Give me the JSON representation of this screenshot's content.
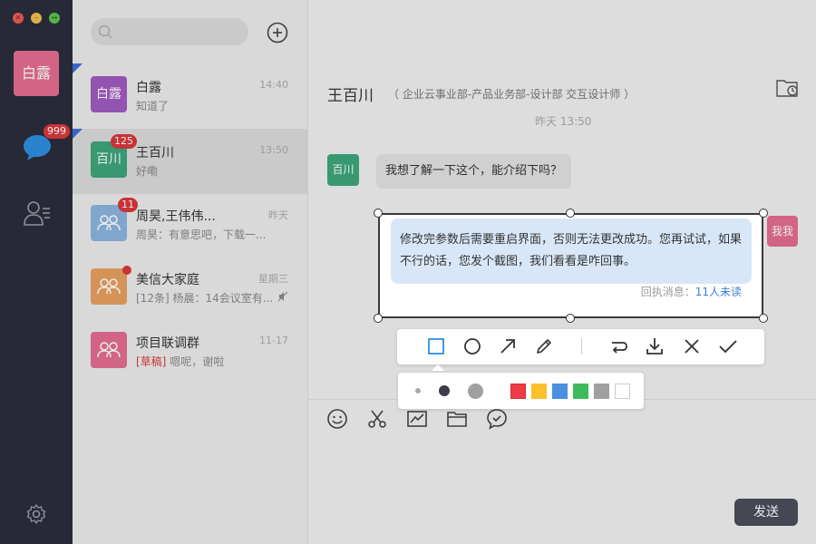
{
  "sidebar": {
    "user_avatar_text": "白露",
    "unread_badge": "999"
  },
  "search": {
    "placeholder": ""
  },
  "conversations": [
    {
      "name": "白露",
      "preview": "知道了",
      "time": "14:40",
      "avatar_text": "白露",
      "avatar_color": "#a05bbf",
      "badge": "",
      "pinned": true
    },
    {
      "name": "王百川",
      "preview": "好嘞",
      "time": "13:50",
      "avatar_text": "百川",
      "avatar_color": "#3da57b",
      "badge": "125",
      "pinned": true
    },
    {
      "name": "周昊,王伟伟...",
      "preview": "周昊：有意思吧，下载一...",
      "time": "昨天",
      "avatar_text": "",
      "avatar_color": "#8bb5e0",
      "badge": "11",
      "pinned": false
    },
    {
      "name": "美信大家庭",
      "preview": "[12条] 杨晨：14会议室有...",
      "time": "星期三",
      "avatar_text": "",
      "avatar_color": "#e8a060",
      "badge": "",
      "pinned": false
    },
    {
      "name": "项目联调群",
      "draft_label": "[草稿]",
      "preview": "嗯呢，谢啦",
      "time": "11-17",
      "avatar_text": "",
      "avatar_color": "#e46d92",
      "badge": "",
      "pinned": false
    }
  ],
  "chat": {
    "title": "王百川",
    "subtitle": "（ 企业云事业部-产品业务部-设计部 交互设计师 ）",
    "timestamp": "昨天  13:50",
    "incoming_avatar": "百川",
    "incoming_message": "我想了解一下这个，能介绍下吗？",
    "outgoing_avatar": "我我",
    "outgoing_message": "修改完参数后需要重启界面，否则无法更改成功。您再试试，如果不行的话，您发个截图，我们看看是咋回事。",
    "receipt_label": "回执消息：",
    "receipt_unread": "11人未读",
    "send_label": "发送"
  },
  "screenshot_tools": [
    "rectangle-icon",
    "circle-icon",
    "arrow-icon",
    "pen-icon",
    "undo-icon",
    "download-icon",
    "close-icon",
    "check-icon"
  ],
  "palette": {
    "sizes": [
      "small",
      "medium",
      "large"
    ],
    "colors": [
      "#ee3b45",
      "#fbc02d",
      "#4a8fe0",
      "#3dbb5a",
      "#a0a0a0",
      "#ffffff"
    ]
  }
}
